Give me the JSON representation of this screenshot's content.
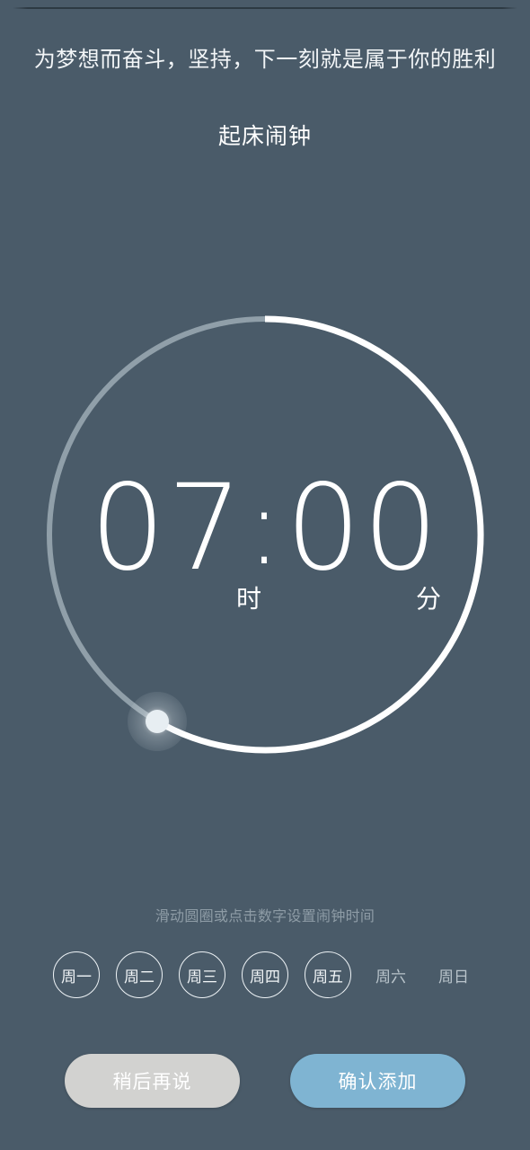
{
  "app": {
    "slogan": "为梦想而奋斗，坚持，下一刻就是属于你的胜利",
    "title": "起床闹钟"
  },
  "clock": {
    "hour": "07",
    "colon": ":",
    "minute": "00",
    "hour_unit": "时",
    "minute_unit": "分",
    "arc_progress_degrees": 210,
    "arc_active_color": "#ffffff",
    "arc_track_color": "#93a3ad",
    "handle_color": "#e7eef2"
  },
  "hint": {
    "text": "滑动圆圈或点击数字设置闹钟时间"
  },
  "weekdays": [
    {
      "label": "周一",
      "selected": true
    },
    {
      "label": "周二",
      "selected": true
    },
    {
      "label": "周三",
      "selected": true
    },
    {
      "label": "周四",
      "selected": true
    },
    {
      "label": "周五",
      "selected": true
    },
    {
      "label": "周六",
      "selected": false
    },
    {
      "label": "周日",
      "selected": false
    }
  ],
  "actions": {
    "cancel_label": "稍后再说",
    "confirm_label": "确认添加",
    "cancel_color": "#d2d2d0",
    "confirm_color": "#7fb4d2"
  },
  "theme": {
    "background": "#4a5b69",
    "text_primary": "#ffffff",
    "text_muted": "#8e9ca6"
  }
}
